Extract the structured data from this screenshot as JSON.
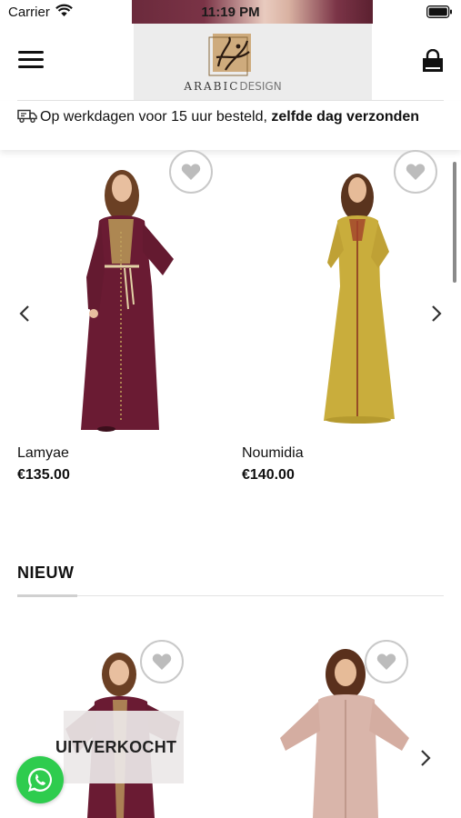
{
  "status_bar": {
    "carrier": "Carrier",
    "time": "11:19 PM"
  },
  "header": {
    "logo_text_bold": "ARABIC",
    "logo_text_light": "DESIGN",
    "menu_icon": "hamburger-icon",
    "cart_icon": "shopping-bag-icon"
  },
  "notice": {
    "text": "Op werkdagen voor 15 uur besteld, ",
    "text_bold": "zelfde dag verzonden",
    "icon": "truck-icon"
  },
  "carousel": {
    "products": [
      {
        "name": "Lamyae",
        "price": "€135.00",
        "color": "#6a1b33"
      },
      {
        "name": "Noumidia",
        "price": "€140.00",
        "color": "#c9ad3c"
      }
    ]
  },
  "section": {
    "title": "NIEUW"
  },
  "new_products": {
    "badge": "UITVERKOCHT",
    "items": [
      {
        "color": "#6a1b33"
      },
      {
        "color": "#d9b5aa"
      }
    ]
  },
  "colors": {
    "whatsapp": "#2ecc4e",
    "text": "#111111"
  }
}
